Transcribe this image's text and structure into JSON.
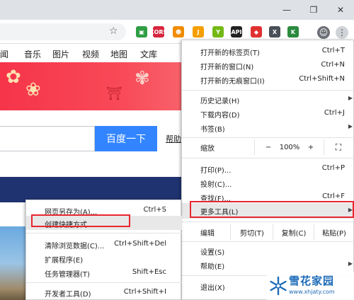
{
  "window": {
    "min": "—",
    "restore": "❐",
    "close": "✕"
  },
  "toolbar": {
    "star": "☆",
    "extensions": [
      {
        "name": "ext-green",
        "glyph": "▣",
        "color": "#2f9e44"
      },
      {
        "name": "ext-cors",
        "glyph": "CORS",
        "color": "#d7263d"
      },
      {
        "name": "ext-cat",
        "glyph": "☻",
        "color": "#f08c00"
      },
      {
        "name": "ext-j",
        "glyph": "J",
        "color": "#f59f00"
      },
      {
        "name": "ext-y",
        "glyph": "Y",
        "color": "#74b816"
      },
      {
        "name": "ext-api",
        "glyph": "API",
        "color": "#222222"
      },
      {
        "name": "ext-flame",
        "glyph": "◆",
        "color": "#e03131"
      },
      {
        "name": "ext-x",
        "glyph": "X",
        "color": "#495057"
      },
      {
        "name": "ext-k",
        "glyph": "K",
        "color": "#2b8a3e"
      }
    ],
    "profile_icon": "☺",
    "menu_icon": "⋮"
  },
  "page": {
    "nav": [
      "闻",
      "音乐",
      "图片",
      "视频",
      "地图",
      "文库"
    ],
    "search_button": "百度一下",
    "help": "帮助"
  },
  "menu": {
    "items": [
      {
        "label": "打开新的标签页(T)",
        "shortcut": "Ctrl+T"
      },
      {
        "label": "打开新的窗口(N)",
        "shortcut": "Ctrl+N"
      },
      {
        "label": "打开新的无痕窗口(I)",
        "shortcut": "Ctrl+Shift+N"
      },
      {
        "label": "历史记录(H)",
        "shortcut": ""
      },
      {
        "label": "下载内容(D)",
        "shortcut": "Ctrl+J"
      },
      {
        "label": "书签(B)",
        "shortcut": ""
      },
      {
        "label": "打印(P)...",
        "shortcut": "Ctrl+P"
      },
      {
        "label": "投射(C)...",
        "shortcut": ""
      },
      {
        "label": "查找(F)...",
        "shortcut": "Ctrl+F"
      },
      {
        "label": "更多工具(L)",
        "shortcut": ""
      },
      {
        "label": "设置(S)",
        "shortcut": ""
      },
      {
        "label": "帮助(E)",
        "shortcut": ""
      },
      {
        "label": "退出(X)",
        "shortcut": ""
      }
    ],
    "zoom": {
      "label": "缩放",
      "minus": "−",
      "value": "100%",
      "plus": "+",
      "fullscreen": "⛶"
    },
    "edit": {
      "label": "编辑",
      "cut": "剪切(T)",
      "copy": "复制(C)",
      "paste": "粘贴(P)"
    }
  },
  "submenu": {
    "items": [
      {
        "label": "网页另存为(A)...",
        "shortcut": "Ctrl+S"
      },
      {
        "label": "创建快捷方式...",
        "shortcut": ""
      },
      {
        "label": "清除浏览数据(C)...",
        "shortcut": "Ctrl+Shift+Del"
      },
      {
        "label": "扩展程序(E)",
        "shortcut": ""
      },
      {
        "label": "任务管理器(T)",
        "shortcut": "Shift+Esc"
      },
      {
        "label": "开发者工具(D)",
        "shortcut": "Ctrl+Shift+I"
      }
    ]
  },
  "watermark": {
    "title": "雪花家园",
    "url": "www.xhjaty.com"
  }
}
